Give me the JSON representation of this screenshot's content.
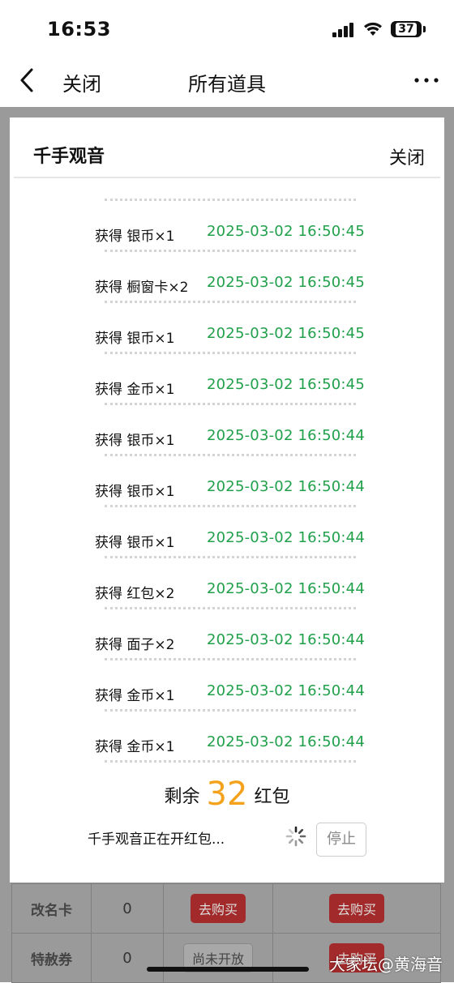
{
  "status_bar": {
    "time": "16:53",
    "battery": "37"
  },
  "nav": {
    "close_label": "关闭",
    "title": "所有道具"
  },
  "modal": {
    "title": "千手观音",
    "close_label": "关闭",
    "log": [
      {
        "text": "获得 银币×1",
        "time": "2025-03-02 16:50:45"
      },
      {
        "text": "获得 橱窗卡×2",
        "time": "2025-03-02 16:50:45"
      },
      {
        "text": "获得 银币×1",
        "time": "2025-03-02 16:50:45"
      },
      {
        "text": "获得 金币×1",
        "time": "2025-03-02 16:50:45"
      },
      {
        "text": "获得 银币×1",
        "time": "2025-03-02 16:50:44"
      },
      {
        "text": "获得 银币×1",
        "time": "2025-03-02 16:50:44"
      },
      {
        "text": "获得 银币×1",
        "time": "2025-03-02 16:50:44"
      },
      {
        "text": "获得 红包×2",
        "time": "2025-03-02 16:50:44"
      },
      {
        "text": "获得 面子×2",
        "time": "2025-03-02 16:50:44"
      },
      {
        "text": "获得 金币×1",
        "time": "2025-03-02 16:50:44"
      },
      {
        "text": "获得 金币×1",
        "time": "2025-03-02 16:50:44"
      }
    ],
    "remaining": {
      "prefix": "剩余",
      "count": "32",
      "suffix": "红包"
    },
    "opening_status": "千手观音正在开红包...",
    "stop_label": "停止"
  },
  "background_table": {
    "rows": [
      {
        "name": "改名卡",
        "count": "0",
        "action1": "去购买",
        "action2": "去购买"
      },
      {
        "name": "特赦券",
        "count": "0",
        "action1": "尚未开放",
        "action2": "去购买"
      }
    ]
  },
  "watermark": "大家坛@黄海音",
  "colors": {
    "time_green": "#21a04b",
    "count_orange": "#f4a21c",
    "buy_red": "#a22a2a"
  },
  "icons": [
    "back-chevron-icon",
    "more-dots-icon",
    "cellular-signal-icon",
    "wifi-icon",
    "battery-icon",
    "loading-spinner-icon"
  ]
}
